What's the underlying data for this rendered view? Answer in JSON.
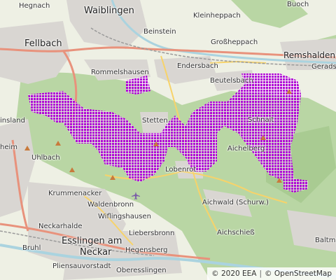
{
  "map": {
    "colors": {
      "land": "#eef0e4",
      "forest": "#b9d6a4",
      "urban": "#d9d6d2",
      "river": "#aad3df",
      "motorway": "#e8927c",
      "road": "#f7d36a",
      "rail": "#9a9a9a",
      "highlight": "#b000d6"
    },
    "places": [
      {
        "name": "Waiblingen",
        "kind": "town"
      },
      {
        "name": "Buoch"
      },
      {
        "name": "Hegnach"
      },
      {
        "name": "Kleinheppach"
      },
      {
        "name": "Fellbach",
        "kind": "town"
      },
      {
        "name": "Beinstein"
      },
      {
        "name": "Großheppach"
      },
      {
        "name": "Remshalden",
        "kind": "town"
      },
      {
        "name": "Gerads"
      },
      {
        "name": "Rommelshausen"
      },
      {
        "name": "Endersbach"
      },
      {
        "name": "Beutelsbach"
      },
      {
        "name": "Stetten"
      },
      {
        "name": "Schnait"
      },
      {
        "name": "insland"
      },
      {
        "name": "heim"
      },
      {
        "name": "Uhlbach"
      },
      {
        "name": "Aichelberg"
      },
      {
        "name": "Lobenrot"
      },
      {
        "name": "Krummenacker"
      },
      {
        "name": "Waldenbronn"
      },
      {
        "name": "Wiflingshausen"
      },
      {
        "name": "Aichwald (Schurw.)"
      },
      {
        "name": "Neckarhalde"
      },
      {
        "name": "Liebersbronn"
      },
      {
        "name": "Aichschieß"
      },
      {
        "name": "Esslingen am",
        "kind": "town"
      },
      {
        "name": "Neckar",
        "kind": "town"
      },
      {
        "name": "Hegensberg"
      },
      {
        "name": "Baltma"
      },
      {
        "name": "Bruhl"
      },
      {
        "name": "Pliensauvorstadt"
      },
      {
        "name": "Oberesslingen"
      }
    ],
    "attribution": {
      "eea": "© 2020 EEA",
      "separator": "|",
      "osm": "© OpenStreetMap"
    }
  }
}
